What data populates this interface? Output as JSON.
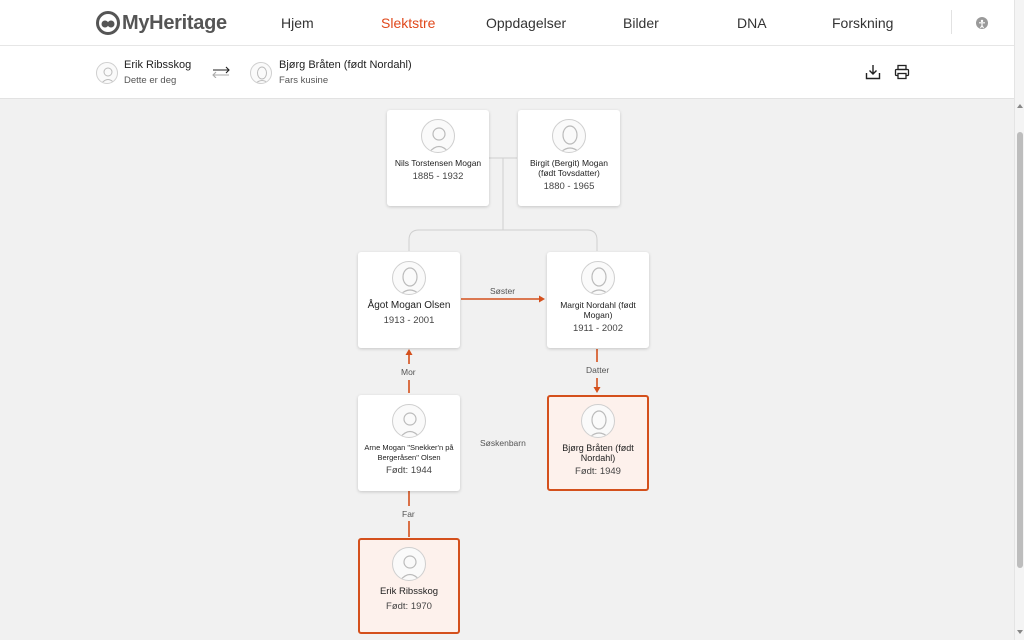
{
  "brand": {
    "name": "MyHeritage"
  },
  "nav": {
    "items": [
      {
        "label": "Hjem",
        "active": false
      },
      {
        "label": "Slektstre",
        "active": true
      },
      {
        "label": "Oppdagelser",
        "active": false
      },
      {
        "label": "Bilder",
        "active": false
      },
      {
        "label": "DNA",
        "active": false
      },
      {
        "label": "Forskning",
        "active": false
      }
    ],
    "accessibility_icon": "accessibility-icon"
  },
  "relationship": {
    "from": {
      "name": "Erik Ribsskog",
      "relation": "Dette er deg"
    },
    "to": {
      "name": "Bjørg Bråten (født Nordahl)",
      "relation": "Fars kusine"
    },
    "swap_icon": "swap-arrows-icon",
    "tools": [
      "download-icon",
      "print-icon"
    ]
  },
  "tree": {
    "people": [
      {
        "id": "nils",
        "name": "Nils Torstensen Mogan",
        "years": "1885 - 1932",
        "gender": "male"
      },
      {
        "id": "birgit",
        "name": "Birgit (Bergit) Mogan (født Tovsdatter)",
        "years": "1880 - 1965",
        "gender": "female"
      },
      {
        "id": "agot",
        "name": "Ågot Mogan Olsen",
        "years": "1913 - 2001",
        "gender": "female"
      },
      {
        "id": "margit",
        "name": "Margit Nordahl (født Mogan)",
        "years": "1911 - 2002",
        "gender": "female"
      },
      {
        "id": "arne",
        "name": "Arne Mogan \"Snekker'n på Bergeråsen\" Olsen",
        "years": "Født: 1944",
        "gender": "male"
      },
      {
        "id": "bjorg",
        "name": "Bjørg Bråten (født Nordahl)",
        "years": "Født: 1949",
        "gender": "female"
      },
      {
        "id": "erik",
        "name": "Erik Ribsskog",
        "years": "Født: 1970",
        "gender": "male"
      }
    ],
    "labels": {
      "sister": "Søster",
      "mother": "Mor",
      "daughter": "Datter",
      "cousins": "Søskenbarn",
      "father": "Far"
    }
  },
  "colors": {
    "accent": "#e0481b",
    "highlight_border": "#d4501c",
    "highlight_bg": "#fdf1ec",
    "line": "#cfcfcf"
  }
}
